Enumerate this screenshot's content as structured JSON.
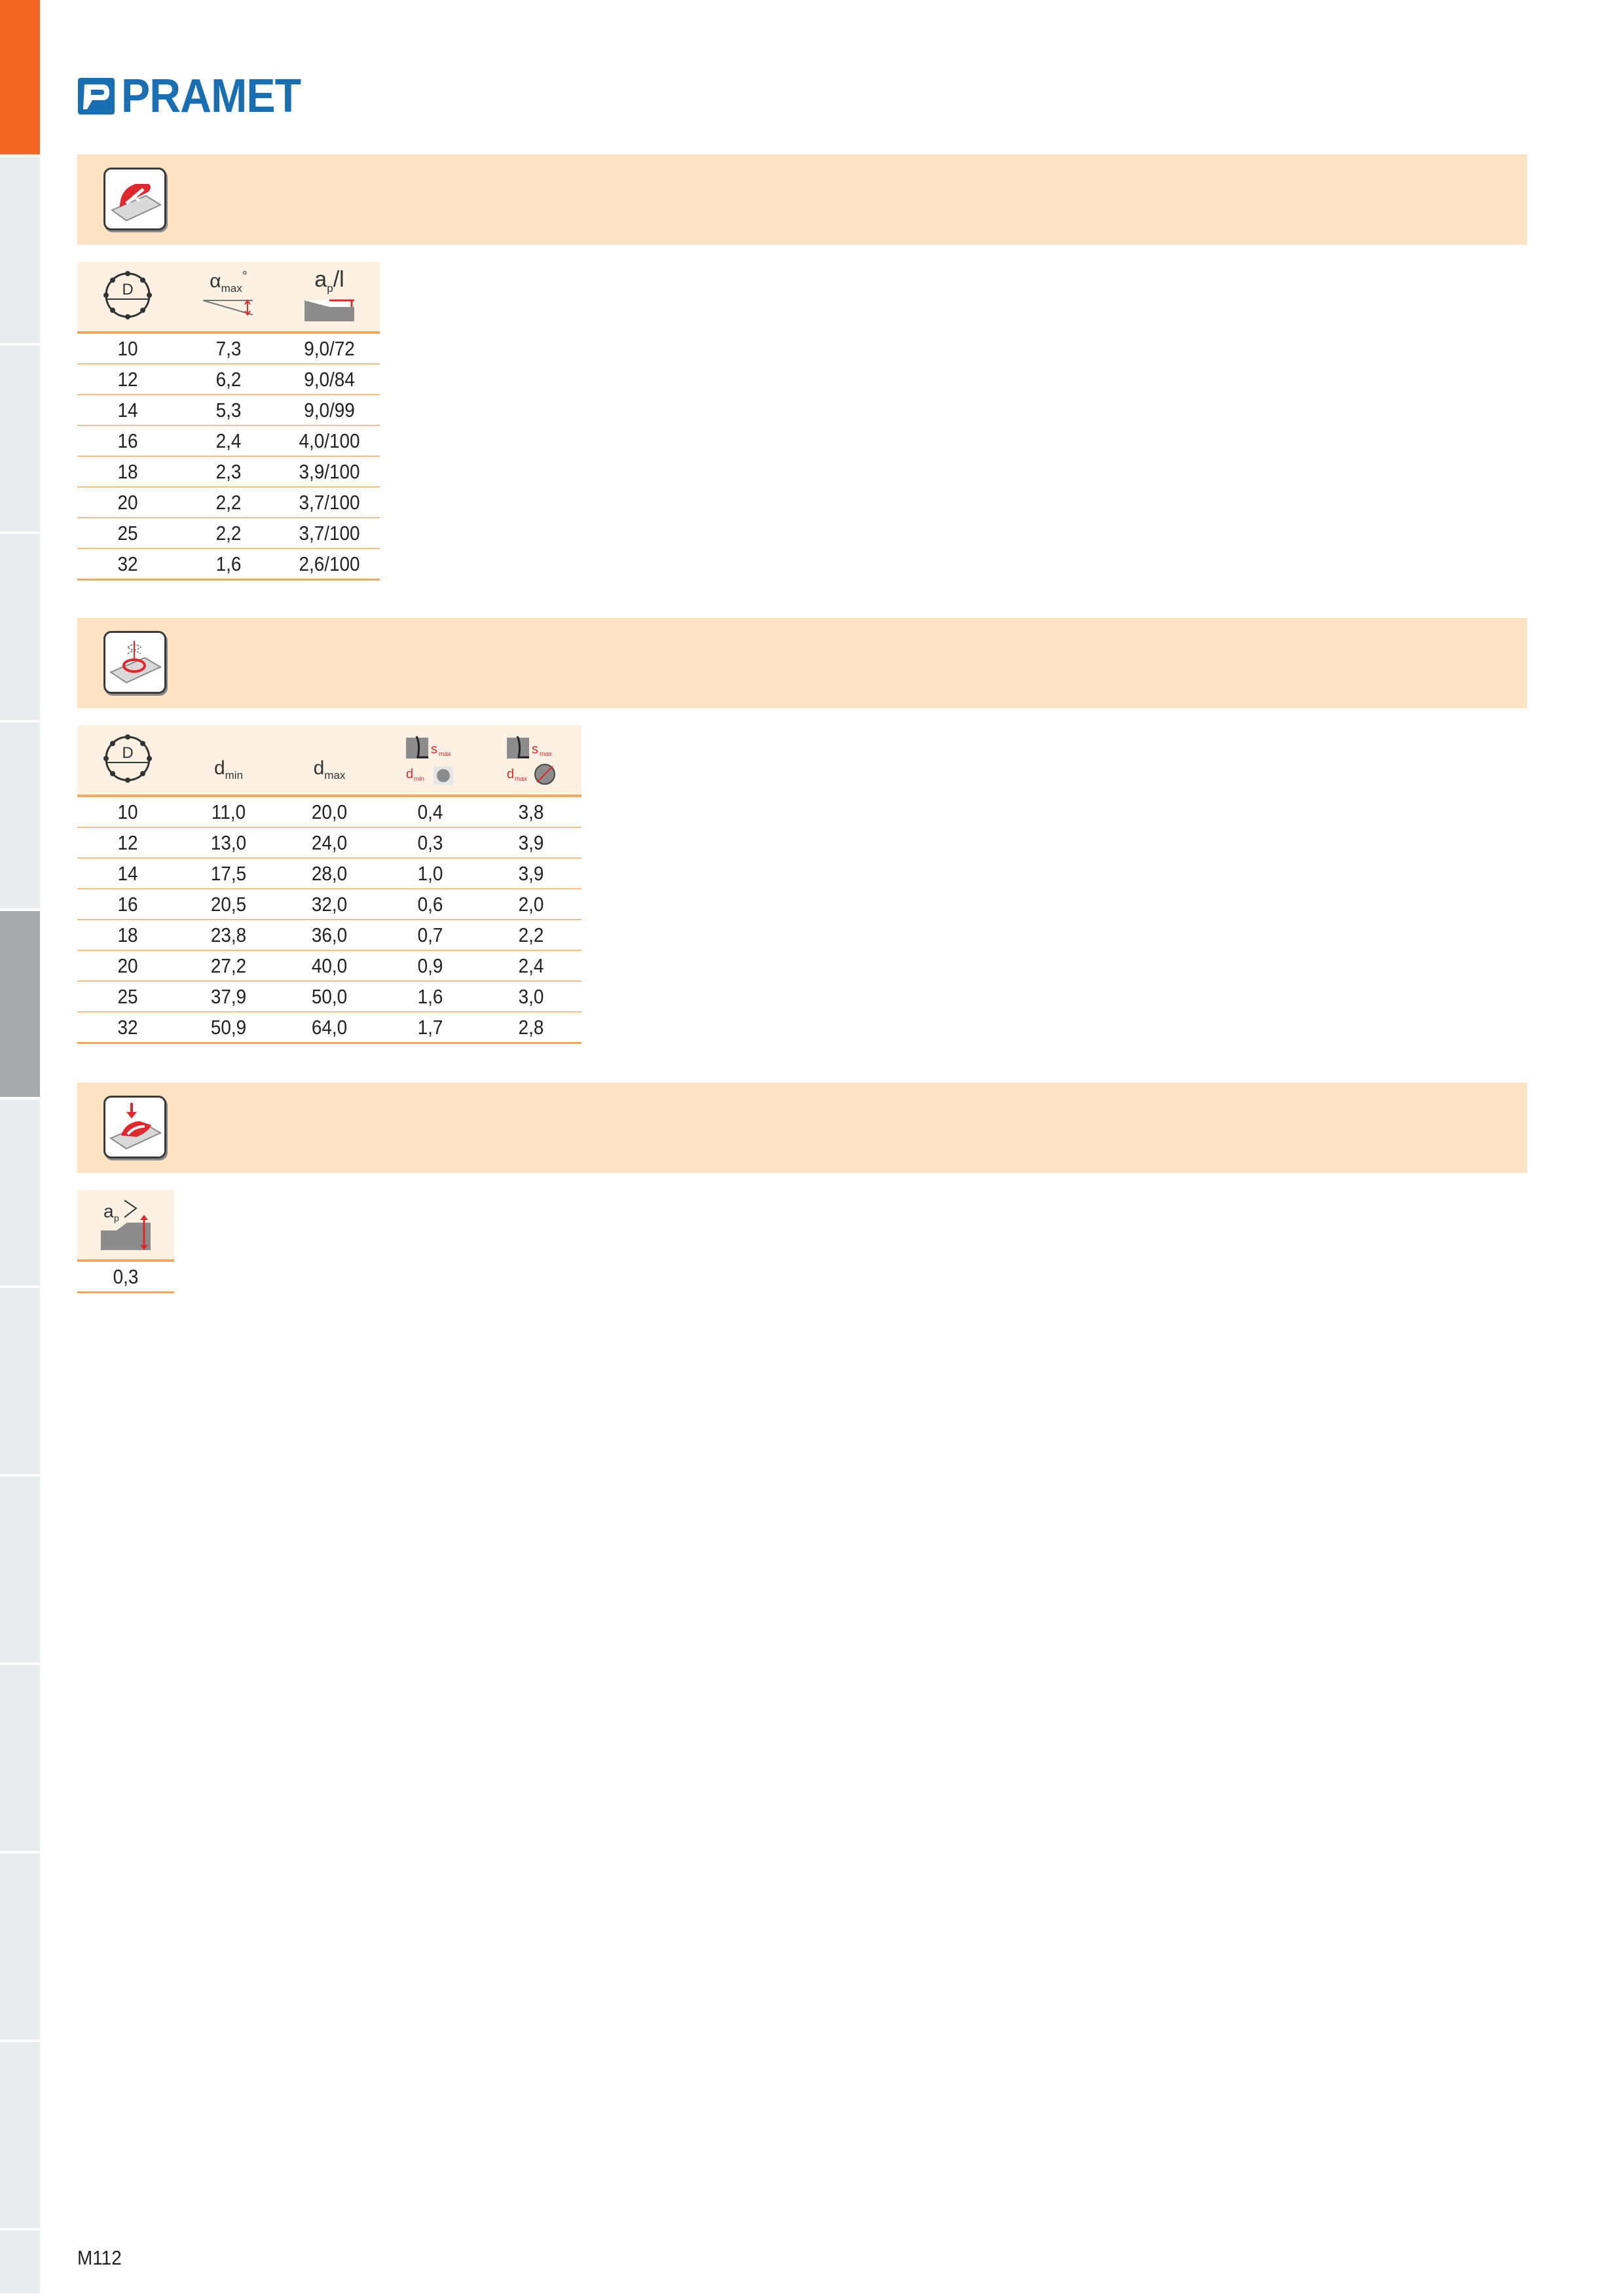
{
  "brand": {
    "name": "PRAMET",
    "color": "#1a6fb3"
  },
  "colors": {
    "accent_orange": "#f26522",
    "banner": "#fde2c4",
    "table_header": "#fdf1e4",
    "rule": "#f0a860",
    "icon_red": "#e0282e"
  },
  "sections": [
    {
      "icon": "ramping-icon"
    },
    {
      "icon": "helical-interpolation-icon"
    },
    {
      "icon": "plunging-icon"
    }
  ],
  "table1": {
    "headers": {
      "col1_symbol": "D",
      "col2_symbol": "α",
      "col2_sub": "max",
      "col2_sup": "°",
      "col3_symbol": "a",
      "col3_sub": "p",
      "col3_suffix": "/l"
    },
    "rows": [
      [
        "10",
        "7,3",
        "9,0/72"
      ],
      [
        "12",
        "6,2",
        "9,0/84"
      ],
      [
        "14",
        "5,3",
        "9,0/99"
      ],
      [
        "16",
        "2,4",
        "4,0/100"
      ],
      [
        "18",
        "2,3",
        "3,9/100"
      ],
      [
        "20",
        "2,2",
        "3,7/100"
      ],
      [
        "25",
        "2,2",
        "3,7/100"
      ],
      [
        "32",
        "1,6",
        "2,6/100"
      ]
    ]
  },
  "table2": {
    "headers": {
      "col1_symbol": "D",
      "col2_symbol": "d",
      "col2_sub": "min",
      "col3_symbol": "d",
      "col3_sub": "max",
      "col4_s": "s",
      "col4_s_sub": "max",
      "col4_d": "d",
      "col4_d_sub": "min",
      "col5_s": "s",
      "col5_s_sub": "max",
      "col5_d": "d",
      "col5_d_sub": "max"
    },
    "rows": [
      [
        "10",
        "11,0",
        "20,0",
        "0,4",
        "3,8"
      ],
      [
        "12",
        "13,0",
        "24,0",
        "0,3",
        "3,9"
      ],
      [
        "14",
        "17,5",
        "28,0",
        "1,0",
        "3,9"
      ],
      [
        "16",
        "20,5",
        "32,0",
        "0,6",
        "2,0"
      ],
      [
        "18",
        "23,8",
        "36,0",
        "0,7",
        "2,2"
      ],
      [
        "20",
        "27,2",
        "40,0",
        "0,9",
        "2,4"
      ],
      [
        "25",
        "37,9",
        "50,0",
        "1,6",
        "3,0"
      ],
      [
        "32",
        "50,9",
        "64,0",
        "1,7",
        "2,8"
      ]
    ]
  },
  "table3": {
    "headers": {
      "col1_symbol": "a",
      "col1_sub": "p"
    },
    "rows": [
      [
        "0,3"
      ]
    ]
  },
  "page_number": "M112"
}
